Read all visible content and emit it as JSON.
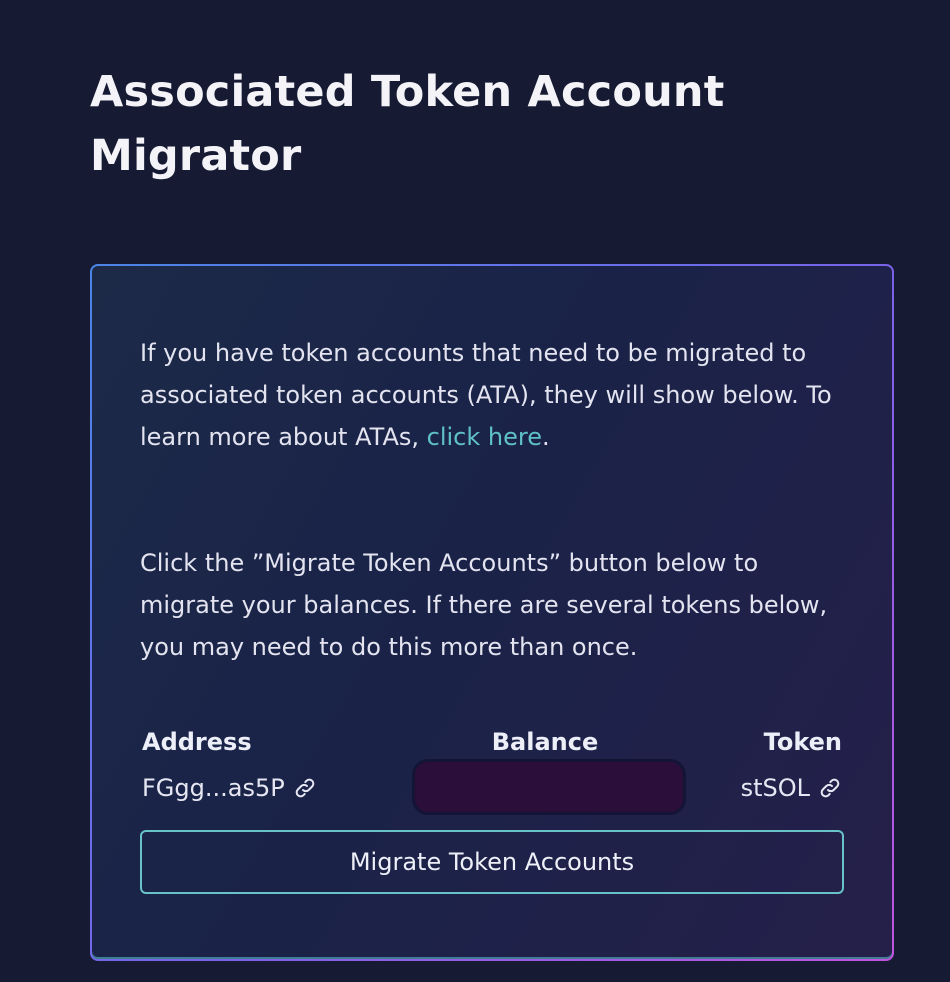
{
  "page": {
    "title": "Associated Token Account Migrator"
  },
  "card": {
    "intro_text": "If you have token accounts that need to be migrated to associated token accounts (ATA), they will show below. To learn more about ATAs, ",
    "intro_link": "click here",
    "intro_end": ".",
    "instructions": "Click the ”Migrate Token Accounts” button below to migrate your balances. If there are several tokens below, you may need to do this more than once.",
    "table": {
      "headers": {
        "address": "Address",
        "balance": "Balance",
        "token": "Token"
      },
      "rows": [
        {
          "address": "FGgg...as5P",
          "address_icon": "link-icon",
          "balance": "",
          "token": "stSOL",
          "token_icon": "link-icon"
        }
      ]
    },
    "button_label": "Migrate Token Accounts"
  },
  "colors": {
    "background": "#161a33",
    "link": "#5fc1c8",
    "button_border": "#67c3c8",
    "balance_pill": "#2c0e3a"
  }
}
